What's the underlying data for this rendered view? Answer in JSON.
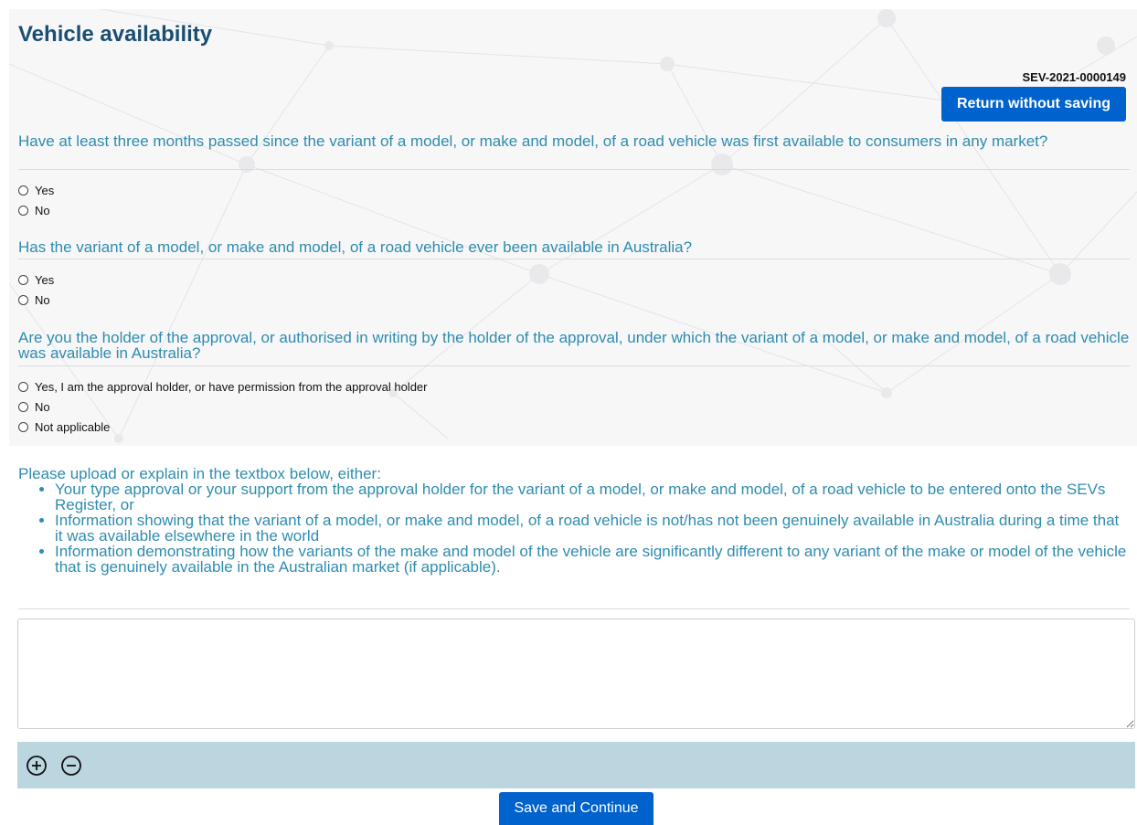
{
  "page": {
    "title": "Vehicle availability",
    "reference": "SEV-2021-0000149",
    "return_label": "Return without saving"
  },
  "questions": [
    {
      "text": "Have at least three months passed since the variant of a model, or make and model, of a road vehicle was first available to consumers in any market?",
      "options": [
        "Yes",
        "No"
      ]
    },
    {
      "text": "Has the variant of a model, or make and model, of a road vehicle ever been available in Australia?",
      "options": [
        "Yes",
        "No"
      ]
    },
    {
      "text": "Are you the holder of the approval, or authorised in writing by the holder of the approval, under which the variant of a model, or make and model, of a road vehicle was available in Australia?",
      "options": [
        "Yes, I am the approval holder, or have permission from the approval holder",
        "No",
        "Not applicable"
      ]
    }
  ],
  "upload": {
    "intro": "Please upload or explain in the textbox below, either:",
    "items": [
      "Your type approval or your support from the approval holder for the variant of a model, or make and model, of a road vehicle to be entered onto the SEVs Register, or",
      "Information showing that the variant of a model, or make and model, of a road vehicle is not/has not been genuinely available in Australia during a time that it was available elsewhere in the world",
      "Information demonstrating how the variants of the make and model of the vehicle are significantly different to any variant of the make or model of the vehicle that is genuinely available in the Australian market (if applicable)."
    ],
    "textbox_value": ""
  },
  "toolbar": {
    "zoom_in_icon": "plus-circle-icon",
    "zoom_out_icon": "minus-circle-icon"
  },
  "footer": {
    "save_label": "Save and Continue"
  },
  "colors": {
    "title": "#1b4f72",
    "question_text": "#2f8cae",
    "primary_button": "#0062cc",
    "toolbar_bg": "#bcd6e0"
  }
}
